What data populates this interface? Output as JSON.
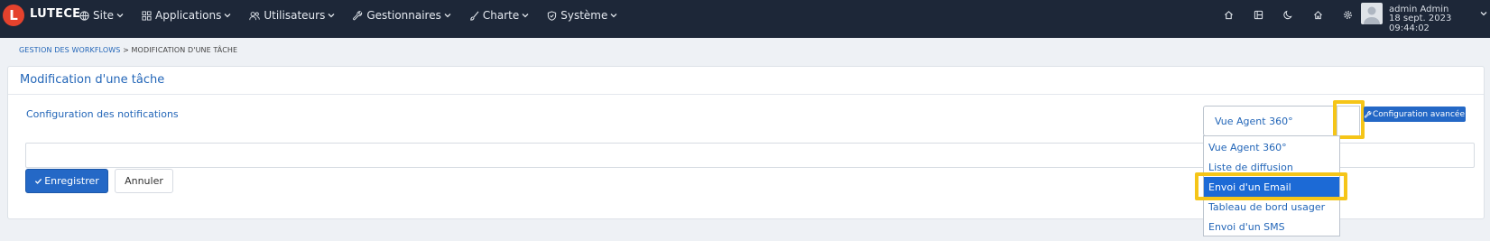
{
  "topbar": {
    "logo_letter": "L",
    "brand": "LUTECE",
    "menu": [
      {
        "label": "Site",
        "icon": "globe-icon"
      },
      {
        "label": "Applications",
        "icon": "grid-icon"
      },
      {
        "label": "Utilisateurs",
        "icon": "users-icon"
      },
      {
        "label": "Gestionnaires",
        "icon": "wrench-icon"
      },
      {
        "label": "Charte",
        "icon": "brush-icon"
      },
      {
        "label": "Système",
        "icon": "shield-icon"
      }
    ],
    "right_icons": [
      "home-icon",
      "layout-icon",
      "moon-icon",
      "home-outline-icon",
      "gear-icon"
    ],
    "user": {
      "name": "admin Admin",
      "date": "18 sept. 2023 09:44:02"
    }
  },
  "breadcrumb": {
    "link": "GESTION DES WORKFLOWS",
    "separator": ">",
    "current": "MODIFICATION D'UNE TÂCHE"
  },
  "card": {
    "title": "Modification d'une tâche",
    "section_label": "Configuration des notifications",
    "wide_input_value": "",
    "save_label": "Enregistrer",
    "cancel_label": "Annuler",
    "advanced_label": "Configuration avancée"
  },
  "select": {
    "value": "Vue Agent 360°",
    "options": [
      "Vue Agent 360°",
      "Liste de diffusion",
      "Envoi d'un Email",
      "Tableau de bord usager",
      "Envoi d'un SMS"
    ],
    "selected_index": 2
  },
  "colors": {
    "topbar": "#1d2738",
    "accent": "#2468c6",
    "link": "#2366b8",
    "highlight": "#f5c518",
    "logo": "#e5422d"
  }
}
